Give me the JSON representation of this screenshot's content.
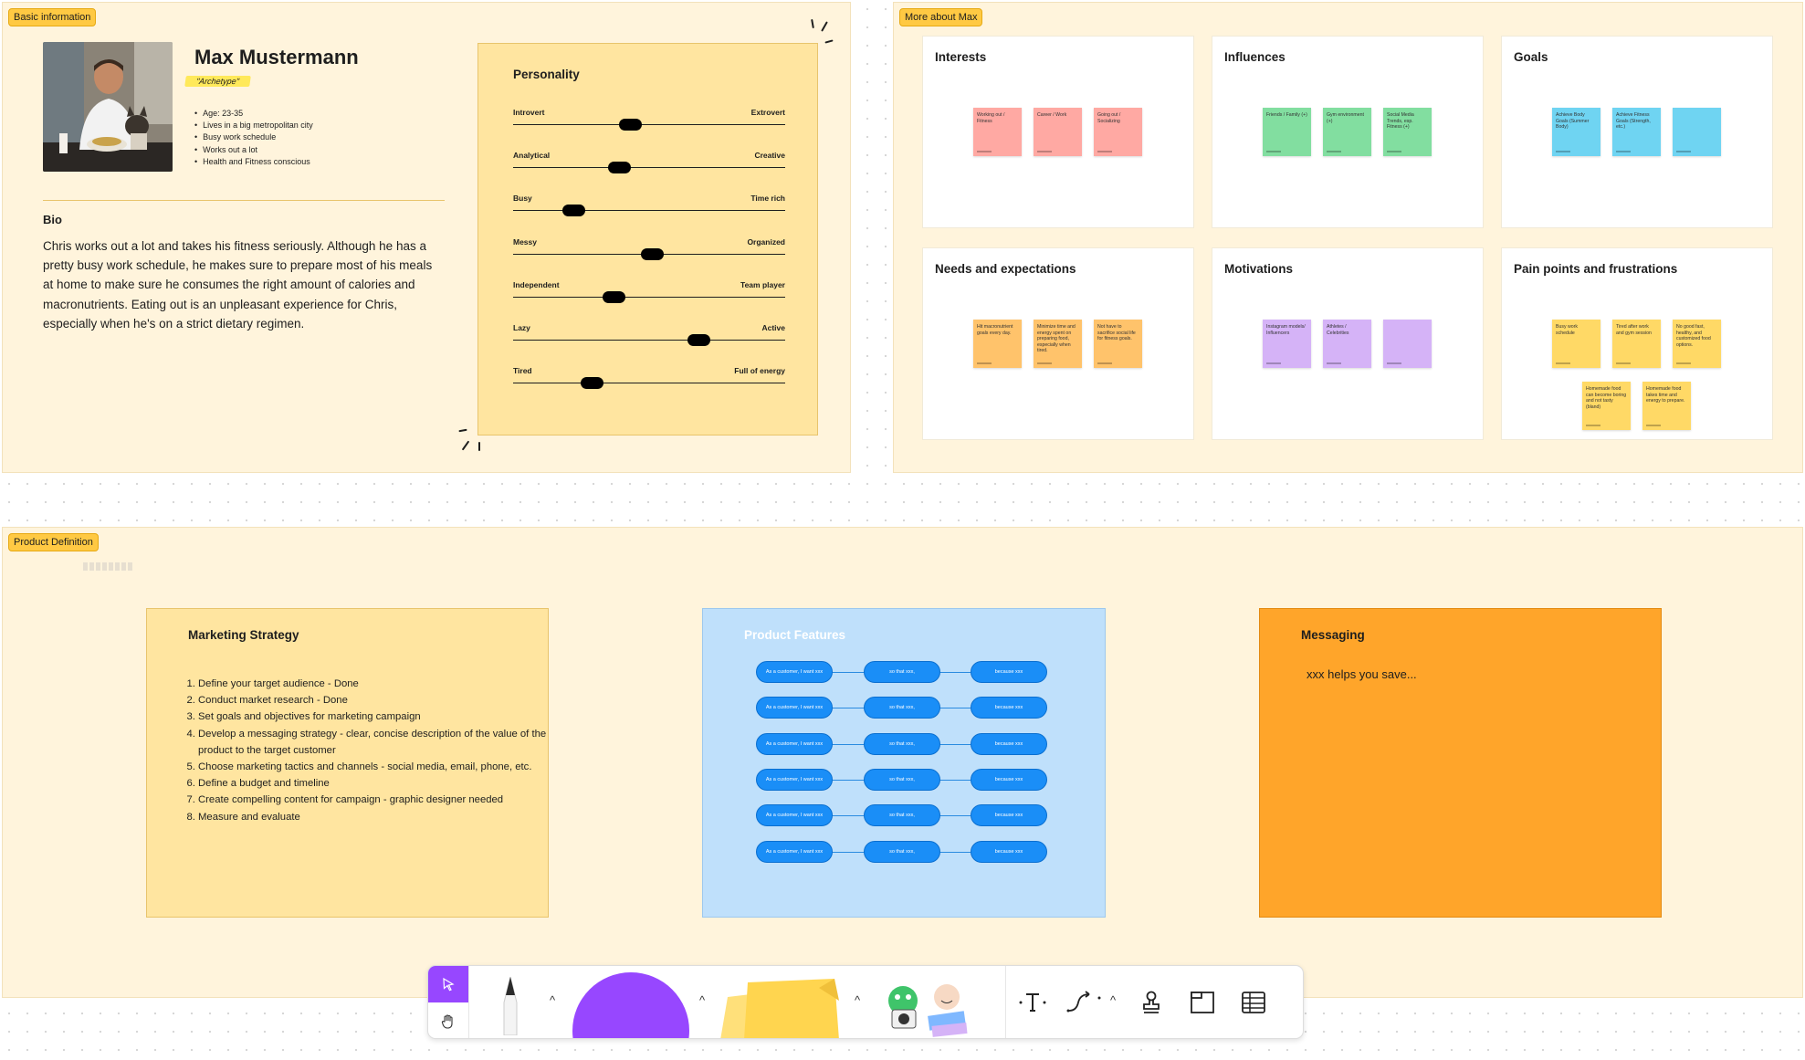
{
  "basic_info": {
    "tag": "Basic information",
    "name": "Max Mustermann",
    "archetype": "\"Archetype\"",
    "facts": [
      "Age: 23-35",
      "Lives in a big metropolitan city",
      "Busy work schedule",
      "Works out a lot",
      "Health and Fitness conscious"
    ],
    "bio_title": "Bio",
    "bio_text": "Chris works out a lot and takes his fitness seriously. Although he has a pretty busy work schedule, he makes sure to prepare most of his meals at home to make sure he consumes the right amount of calories and macronutrients. Eating out is an unpleasant experience for Chris, especially when he's on a strict dietary regimen.",
    "personality": {
      "title": "Personality",
      "sliders": [
        {
          "left": "Introvert",
          "right": "Extrovert",
          "value": 0.43
        },
        {
          "left": "Analytical",
          "right": "Creative",
          "value": 0.39
        },
        {
          "left": "Busy",
          "right": "Time rich",
          "value": 0.22
        },
        {
          "left": "Messy",
          "right": "Organized",
          "value": 0.51
        },
        {
          "left": "Independent",
          "right": "Team player",
          "value": 0.37
        },
        {
          "left": "Lazy",
          "right": "Active",
          "value": 0.68
        },
        {
          "left": "Tired",
          "right": "Full of energy",
          "value": 0.29
        }
      ]
    }
  },
  "more_about": {
    "tag": "More about Max",
    "cards": [
      {
        "title": "Interests",
        "stickies": [
          {
            "text": "Working out / Fitness",
            "color": "#ffa9a3"
          },
          {
            "text": "Career / Work",
            "color": "#ffa9a3"
          },
          {
            "text": "Going out / Socializing",
            "color": "#ffa9a3"
          }
        ]
      },
      {
        "title": "Influences",
        "stickies": [
          {
            "text": "Friends / Family (+)",
            "color": "#82dea0"
          },
          {
            "text": "Gym environment (+)",
            "color": "#82dea0"
          },
          {
            "text": "Social Media Trends, esp. Fitness (+)",
            "color": "#82dea0"
          }
        ]
      },
      {
        "title": "Goals",
        "stickies": [
          {
            "text": "Achieve Body Goals (Summer Body)",
            "color": "#6fd4f2"
          },
          {
            "text": "Achieve Fitness Goals (Strength, etc.)",
            "color": "#6fd4f2"
          },
          {
            "text": "",
            "color": "#6fd4f2"
          }
        ]
      },
      {
        "title": "Needs and expectations",
        "stickies": [
          {
            "text": "Hit macronutrient goals every day.",
            "color": "#ffc36b"
          },
          {
            "text": "Minimize time and energy spent on preparing food, especially when tired.",
            "color": "#ffc36b"
          },
          {
            "text": "Not have to sacrifice social life for fitness goals.",
            "color": "#ffc36b"
          }
        ]
      },
      {
        "title": "Motivations",
        "stickies": [
          {
            "text": "Instagram models/ Influencers",
            "color": "#d5b3f7"
          },
          {
            "text": "Athletes / Celebrities",
            "color": "#d5b3f7"
          },
          {
            "text": "",
            "color": "#d5b3f7"
          }
        ]
      },
      {
        "title": "Pain points and frustrations",
        "stickies": [
          {
            "text": "Busy work schedule",
            "color": "#ffd966"
          },
          {
            "text": "Tired after work and gym session",
            "color": "#ffd966"
          },
          {
            "text": "No good fast, healthy, and customized food options.",
            "color": "#ffd966"
          },
          {
            "text": "Homemade food can become boring and not tasty (bland)",
            "color": "#ffd966"
          },
          {
            "text": "Homemade food takes time and energy to prepare.",
            "color": "#ffd966"
          }
        ]
      }
    ]
  },
  "product_definition": {
    "tag": "Product Definition",
    "marketing": {
      "title": "Marketing Strategy",
      "steps": [
        "Define your target audience - Done",
        "Conduct market research - Done",
        "Set goals and objectives for marketing campaign",
        "Develop a messaging strategy - clear, concise description of the value of the product to the target customer",
        "Choose marketing tactics and channels - social media, email, phone, etc.",
        "Define a budget and timeline",
        "Create compelling content for campaign - graphic designer needed",
        "Measure and evaluate"
      ]
    },
    "features": {
      "title": "Product Features",
      "rows": [
        [
          "As a customer, I want xxx",
          "so that xxx,",
          "because xxx"
        ],
        [
          "As a customer, I want xxx",
          "so that xxx,",
          "because xxx"
        ],
        [
          "As a customer, I want xxx",
          "so that xxx,",
          "because xxx"
        ],
        [
          "As a customer, I want xxx",
          "so that xxx,",
          "because xxx"
        ],
        [
          "As a customer, I want xxx",
          "so that xxx,",
          "because xxx"
        ],
        [
          "As a customer, I want xxx",
          "so that xxx,",
          "because xxx"
        ]
      ]
    },
    "messaging": {
      "title": "Messaging",
      "text": "xxx helps you save..."
    }
  },
  "toolbar": {
    "tools": [
      "select-tool",
      "hand-tool",
      "pen-tool",
      "shape-tool",
      "sticky-note-tool",
      "stickers-tool",
      "text-tool",
      "connector-tool",
      "stamp-tool",
      "section-tool",
      "table-tool"
    ],
    "accent_color": "#9747ff",
    "shape_color": "#9747ff",
    "sticky_color": "#ffd966"
  }
}
